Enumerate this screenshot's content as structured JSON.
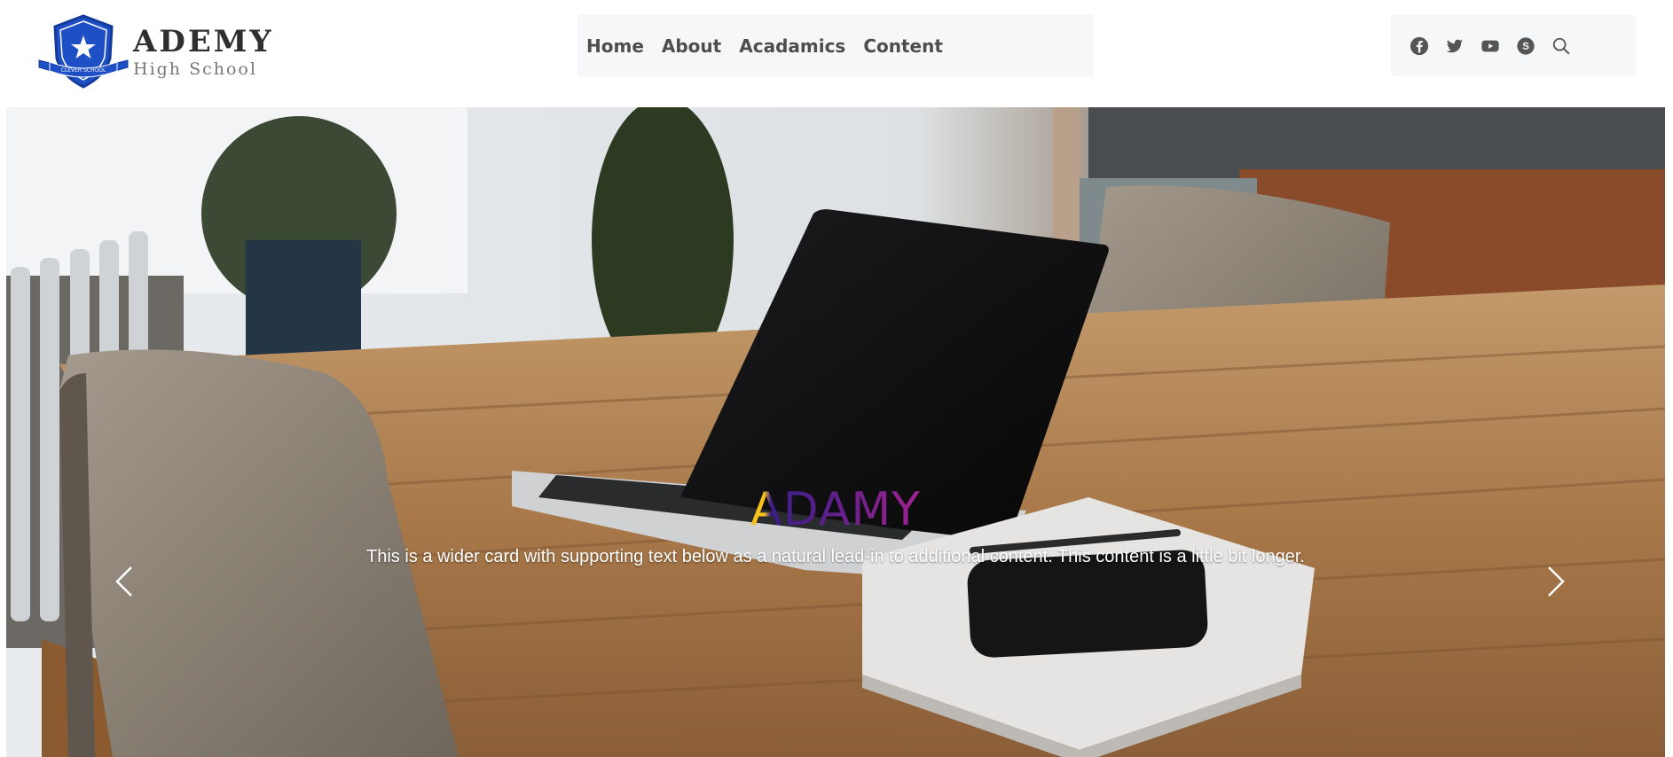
{
  "brand": {
    "name": "ADEMY",
    "subtitle": "High School",
    "crest_banner_text": "CLEVER SCHOOL",
    "crest_color": "#1e4fc4"
  },
  "nav": {
    "items": [
      {
        "label": "Home"
      },
      {
        "label": "About"
      },
      {
        "label": "Acadamics"
      },
      {
        "label": "Content"
      }
    ]
  },
  "social": {
    "icons": [
      "facebook-icon",
      "twitter-icon",
      "youtube-icon",
      "skype-icon",
      "search-icon"
    ],
    "icon_color": "#555555"
  },
  "hero": {
    "title": "ADAMY",
    "text": "This is a wider card with supporting text below as a natural lead-in to additional content. This content is a little bit longer.",
    "title_colors": [
      "#f6c21a",
      "#3b1d86",
      "#a0228f"
    ],
    "prev_icon": "chevron-left-icon",
    "next_icon": "chevron-right-icon"
  }
}
